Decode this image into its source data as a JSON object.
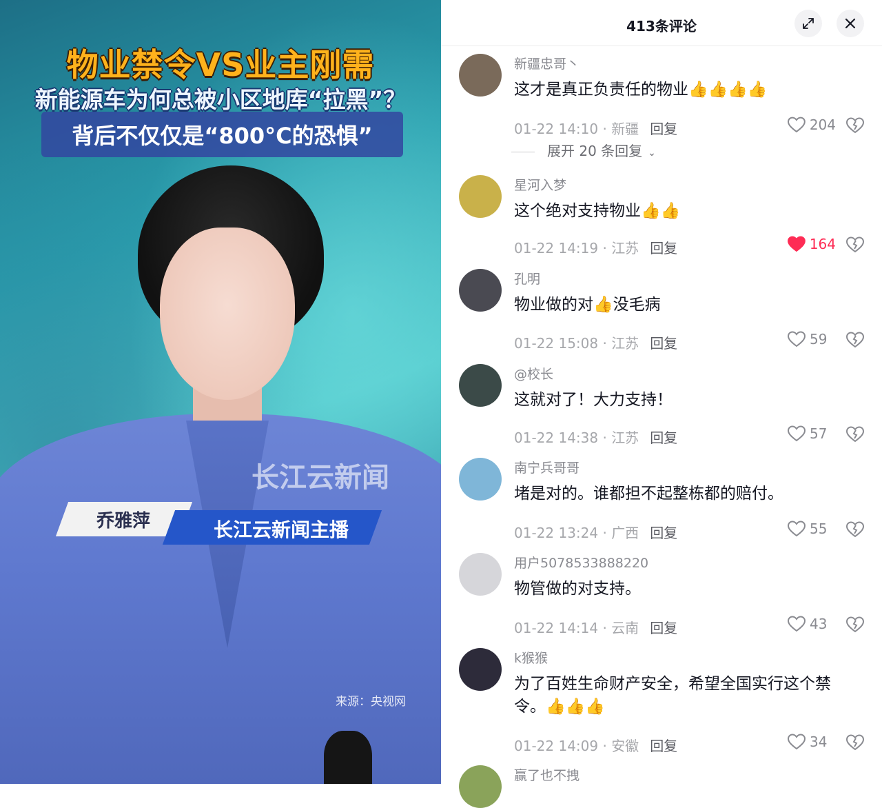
{
  "video": {
    "title_line1": "物业禁令VS业主刚需",
    "title_line2": "新能源车为何总被小区地库“拉黑”？",
    "title_line3": "背后不仅仅是“800°C的恐惧”",
    "watermark": "长江云新闻",
    "anchor_name": "乔雅萍",
    "anchor_title": "长江云新闻主播",
    "source": "来源：央视网"
  },
  "panel": {
    "header_title": "413条评论",
    "expand_icon": "expand-arrows-icon",
    "close_icon": "close-icon",
    "expand_replies": "展开 20 条回复",
    "reply_label": "回复",
    "comments": [
      {
        "user": "新疆忠哥丶",
        "text": "这才是真正负责任的物业👍👍👍👍",
        "time": "01-22 14:10",
        "region": "新疆",
        "likes": "204",
        "liked": false,
        "avatar_color": "#7a6a5a"
      },
      {
        "user": "星河入梦",
        "text": "这个绝对支持物业👍👍",
        "time": "01-22 14:19",
        "region": "江苏",
        "likes": "164",
        "liked": true,
        "avatar_color": "#c9b14a"
      },
      {
        "user": "孔明",
        "text": "物业做的对👍没毛病",
        "time": "01-22 15:08",
        "region": "江苏",
        "likes": "59",
        "liked": false,
        "avatar_color": "#4a4a52"
      },
      {
        "user": "@校长",
        "text": "这就对了！大力支持！",
        "time": "01-22 14:38",
        "region": "江苏",
        "likes": "57",
        "liked": false,
        "avatar_color": "#3b4a48"
      },
      {
        "user": "南宁兵哥哥",
        "text": "堵是对的。谁都担不起整栋都的赔付。",
        "time": "01-22 13:24",
        "region": "广西",
        "likes": "55",
        "liked": false,
        "avatar_color": "#7fb6d8"
      },
      {
        "user": "用户5078533888220",
        "text": "物管做的对支持。",
        "time": "01-22 14:14",
        "region": "云南",
        "likes": "43",
        "liked": false,
        "avatar_color": "#d6d6da"
      },
      {
        "user": "k猴猴",
        "text": "为了百姓生命财产安全，希望全国实行这个禁令。👍👍👍",
        "time": "01-22 14:09",
        "region": "安徽",
        "likes": "34",
        "liked": false,
        "avatar_color": "#2d2b3a"
      },
      {
        "user": "赢了也不拽",
        "avatar_color": "#8aa35a"
      }
    ]
  }
}
